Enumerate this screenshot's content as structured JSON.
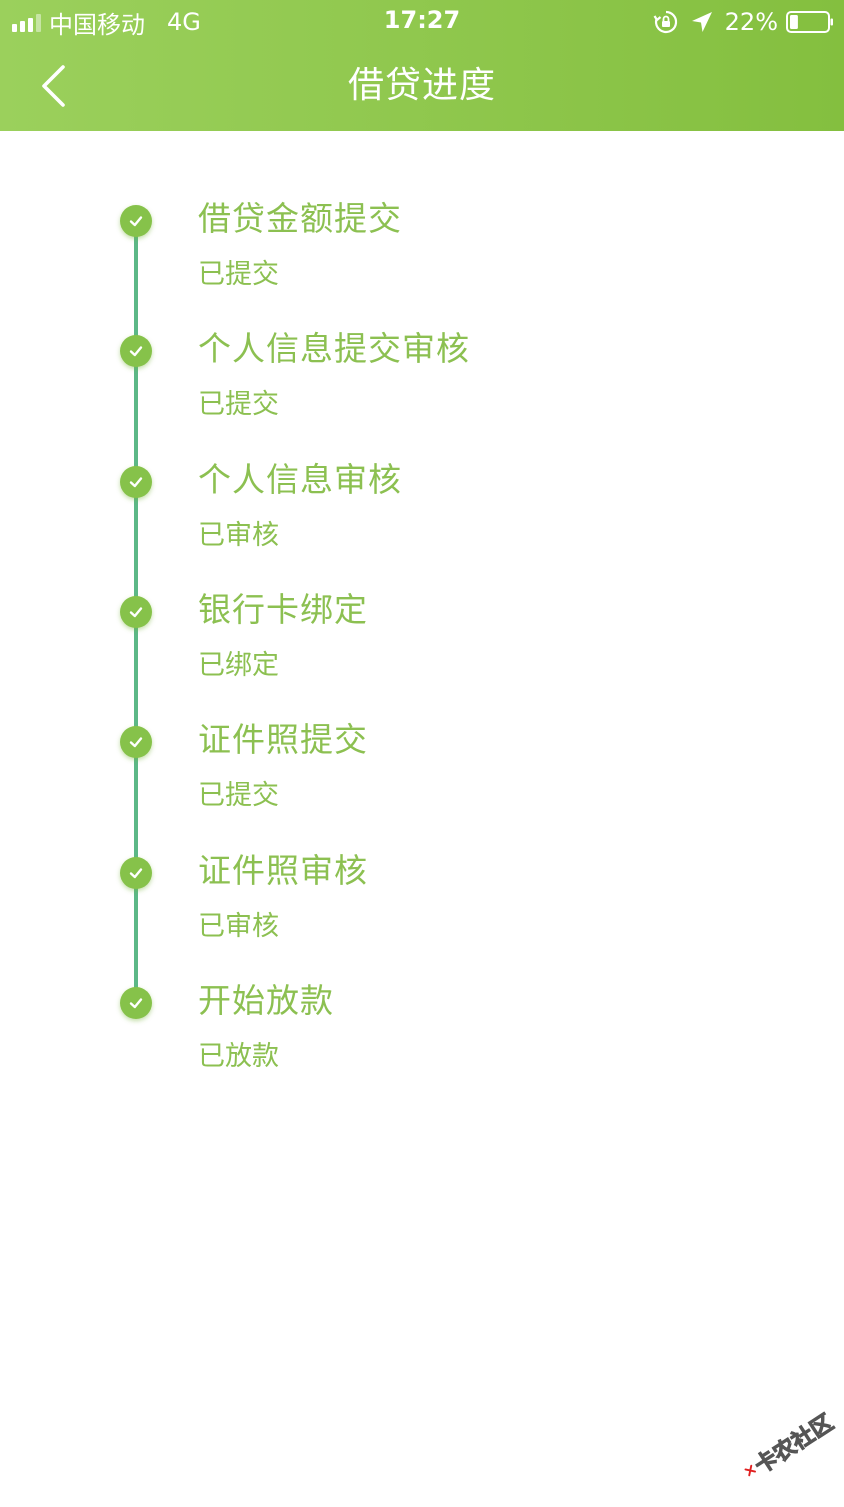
{
  "status_bar": {
    "carrier": "中国移动",
    "network": "4G",
    "time": "17:27",
    "battery": "22%",
    "battery_level": 0.22
  },
  "header": {
    "title": "借贷进度"
  },
  "steps": [
    {
      "title": "借贷金额提交",
      "status": "已提交"
    },
    {
      "title": "个人信息提交审核",
      "status": "已提交"
    },
    {
      "title": "个人信息审核",
      "status": "已审核"
    },
    {
      "title": "银行卡绑定",
      "status": "已绑定"
    },
    {
      "title": "证件照提交",
      "status": "已提交"
    },
    {
      "title": "证件照审核",
      "status": "已审核"
    },
    {
      "title": "开始放款",
      "status": "已放款"
    }
  ],
  "watermark": {
    "text": "卡农社区"
  },
  "colors": {
    "header_start": "#9bd05c",
    "header_end": "#84bf3f",
    "step_text": "#8cc051",
    "timeline_line": "#5cb887",
    "check_dot": "#86c24a"
  }
}
